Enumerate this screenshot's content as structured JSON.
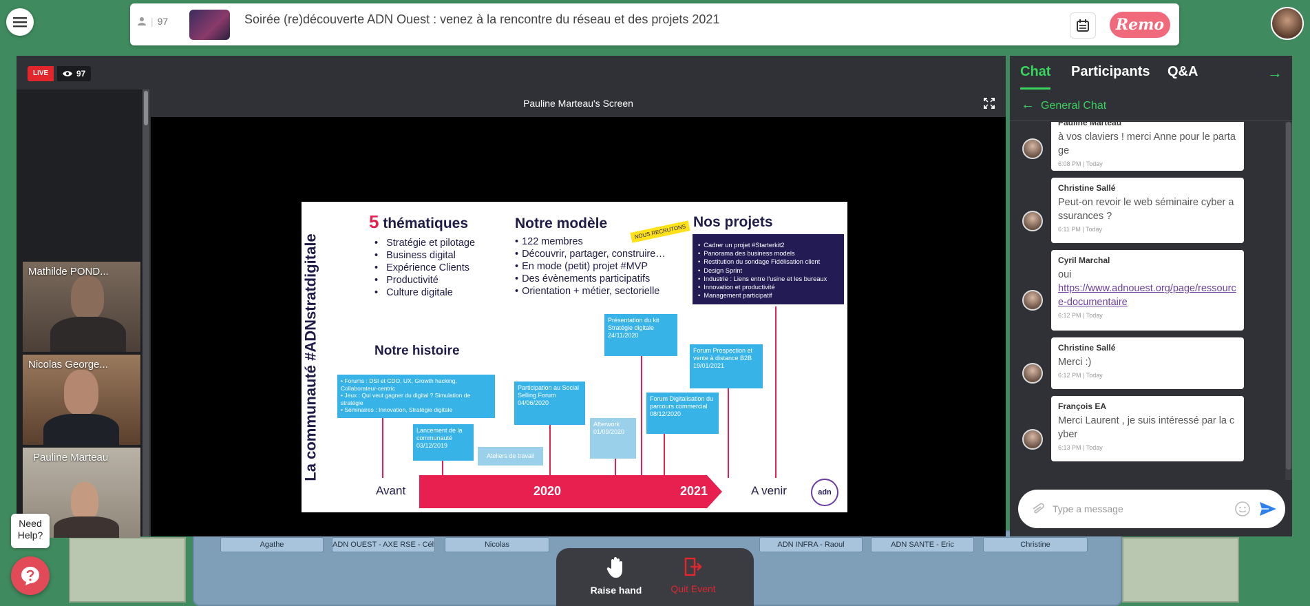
{
  "header": {
    "attendee_count": "97",
    "event_title": "Soirée (re)découverte ADN Ouest : venez à la rencontre du réseau et des projets 2021",
    "logo_text": "Remo"
  },
  "stage": {
    "live_label": "LIVE",
    "viewer_count": "97",
    "screen_title": "Pauline Marteau's Screen",
    "cameras": [
      {
        "name": "Mathilde POND..."
      },
      {
        "name": "Nicolas George..."
      },
      {
        "name": "Pauline Marteau"
      }
    ]
  },
  "slide": {
    "vertical_title": "La communauté #ADNstratdigitale",
    "themes_number": "5",
    "themes_heading": "thématiques",
    "themes": [
      "Stratégie et pilotage",
      "Business digital",
      "Expérience Clients",
      "Productivité",
      "Culture digitale"
    ],
    "model_heading": "Notre modèle",
    "model_items": [
      "122 membres",
      "Découvrir, partager, construire…",
      "En mode (petit) projet #MVP",
      "Des évènements participatifs",
      "Orientation + métier, sectorielle"
    ],
    "recruit_tag": "NOUS RECRUTONS",
    "projects_heading": "Nos projets",
    "projects": [
      "Cadrer un projet #Starterkit2",
      "Panorama des business models",
      "Restitution du sondage Fidélisation client",
      "Design Sprint",
      "Industrie : Liens entre l'usine et les bureaux",
      "Innovation et productivité",
      "Management participatif"
    ],
    "history_heading": "Notre histoire",
    "history_box_lines": [
      "Forums : DSI et CDO, UX, Growth hacking, Collaborateur-centric",
      "Jeux : Qui veut gagner du digital ? Simulation de stratégie",
      "Séminaires : Innovation, Stratégie digitale"
    ],
    "events": {
      "launch": "Lancement de la communauté 03/12/2019",
      "workshops": "Ateliers de travail",
      "social_selling": "Participation au Social Selling Forum 04/06/2020",
      "afterwork": "Afterwork 01/09/2020",
      "kit": "Présentation du kit Stratégie digitale 24/11/2020",
      "forum_digital": "Forum Digitalisation du parcours commercial 08/12/2020",
      "forum_prospection": "Forum Prospection et vente à distance B2B 19/01/2021"
    },
    "timeline": {
      "before": "Avant",
      "year1": "2020",
      "year2": "2021",
      "after": "A venir"
    },
    "logo_text": "adn"
  },
  "chat": {
    "tabs": [
      "Chat",
      "Participants",
      "Q&A"
    ],
    "channel": "General Chat",
    "messages": [
      {
        "author": "Pauline Marteau",
        "text": "à vos claviers ! merci Anne pour le partage",
        "time": "6:08 PM | Today"
      },
      {
        "author": "Christine Sallé",
        "text": "Peut-on revoir le web séminaire cyber assurances ?",
        "time": "6:11 PM | Today"
      },
      {
        "author": "Cyril Marchal",
        "text": "oui",
        "link": "https://www.adnouest.org/page/ressource-documentaire",
        "time": "6:12 PM | Today"
      },
      {
        "author": "Christine Sallé",
        "text": "Merci :)",
        "time": "6:12 PM | Today"
      },
      {
        "author": "François EA",
        "text": "Merci Laurent , je suis intéressé par la cyber",
        "time": "6:13 PM | Today"
      }
    ],
    "input_placeholder": "Type a message"
  },
  "bottom_bar": {
    "raise_hand": "Raise hand",
    "quit_event": "Quit Event"
  },
  "help": {
    "tooltip_line1": "Need",
    "tooltip_line2": "Help?"
  },
  "floor_labels": [
    "Agathe",
    "ADN OUEST - AXE RSE - Céline",
    "Nicolas",
    "ADN INFRA - Raoul",
    "ADN SANTE - Eric",
    "Christine"
  ],
  "colors": {
    "accent_green": "#3ad35e",
    "live_red": "#e2262c",
    "brand_pink": "#f16a7c",
    "quit_red": "#e2262c",
    "slide_pink": "#e8204f",
    "slide_blue": "#38b3e8",
    "slide_navy": "#221b54"
  }
}
